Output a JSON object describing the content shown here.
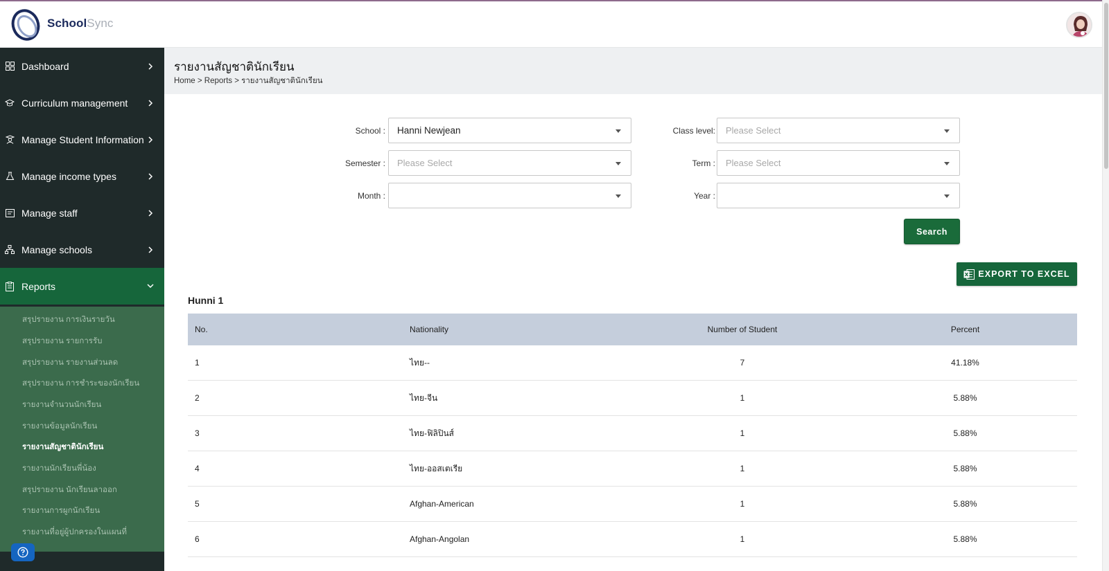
{
  "app": {
    "brand_part1": "School",
    "brand_part2": "Sync"
  },
  "sidebar": {
    "items": [
      {
        "label": "Dashboard",
        "icon": "grid-icon"
      },
      {
        "label": "Curriculum management",
        "icon": "graduation-cap-icon"
      },
      {
        "label": "Manage Student Information",
        "icon": "student-icon"
      },
      {
        "label": "Manage income types",
        "icon": "flask-icon"
      },
      {
        "label": "Manage staff",
        "icon": "id-card-icon"
      },
      {
        "label": "Manage schools",
        "icon": "hierarchy-icon"
      },
      {
        "label": "Reports",
        "icon": "clipboard-icon",
        "active": true
      }
    ],
    "sub_items": [
      "สรุปรายงาน การเงินรายวัน",
      "สรุปรายงาน รายการรับ",
      "สรุปรายงาน รายงานส่วนลด",
      "สรุปรายงาน การชำระของนักเรียน",
      "รายงานจำนวนนักเรียน",
      "รายงานข้อมูลนักเรียน",
      "รายงานสัญชาตินักเรียน",
      "รายงานนักเรียนพี่น้อง",
      "สรุปรายงาน นักเรียนลาออก",
      "รายงานการผูกนักเรียน",
      "รายงานที่อยู่ผู้ปกครองในแผนที่"
    ],
    "current_sub_index": 6
  },
  "header": {
    "title": "รายงานสัญชาตินักเรียน",
    "breadcrumb": "Home > Reports > รายงานสัญชาตินักเรียน"
  },
  "filters": {
    "school_label": "School :",
    "school_value": "Hanni Newjean",
    "class_level_label": "Class level:",
    "class_level_placeholder": "Please Select",
    "semester_label": "Semester :",
    "semester_placeholder": "Please Select",
    "term_label": "Term :",
    "term_placeholder": "Please Select",
    "month_label": "Month :",
    "month_value": "",
    "year_label": "Year :",
    "year_value": ""
  },
  "actions": {
    "search_label": "Search",
    "export_label": "EXPORT TO EXCEL"
  },
  "report": {
    "group_title": "Hunni 1",
    "columns": [
      "No.",
      "Nationality",
      "Number of Student",
      "Percent"
    ],
    "rows": [
      [
        "1",
        "ไทย--",
        "7",
        "41.18%"
      ],
      [
        "2",
        "ไทย-จีน",
        "1",
        "5.88%"
      ],
      [
        "3",
        "ไทย-ฟิลิปินส์",
        "1",
        "5.88%"
      ],
      [
        "4",
        "ไทย-ออสเตเรีย",
        "1",
        "5.88%"
      ],
      [
        "5",
        "Afghan-American",
        "1",
        "5.88%"
      ],
      [
        "6",
        "Afghan-Angolan",
        "1",
        "5.88%"
      ]
    ]
  },
  "colors": {
    "sidebar_bg": "#1f2a2a",
    "active_nav": "#16663b",
    "sub_panel": "#3b6b4c",
    "table_header": "#c5cedc",
    "primary_button": "#1a6b3a"
  }
}
